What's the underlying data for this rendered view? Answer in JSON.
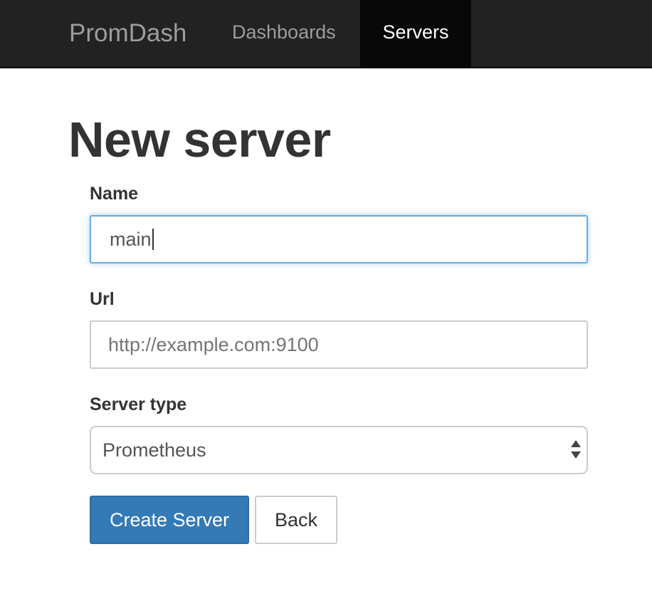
{
  "navbar": {
    "brand": "PromDash",
    "items": [
      {
        "label": "Dashboards",
        "active": false
      },
      {
        "label": "Servers",
        "active": true
      }
    ],
    "bg_color": "#222222",
    "active_bg_color": "#080808"
  },
  "page": {
    "title": "New server"
  },
  "form": {
    "name": {
      "label": "Name",
      "value": "main"
    },
    "url": {
      "label": "Url",
      "placeholder": "http://example.com:9100"
    },
    "server_type": {
      "label": "Server type",
      "selected": "Prometheus"
    },
    "buttons": {
      "submit_label": "Create Server",
      "back_label": "Back"
    },
    "accent_color": "#337ab7",
    "focus_color": "#66afe9"
  }
}
